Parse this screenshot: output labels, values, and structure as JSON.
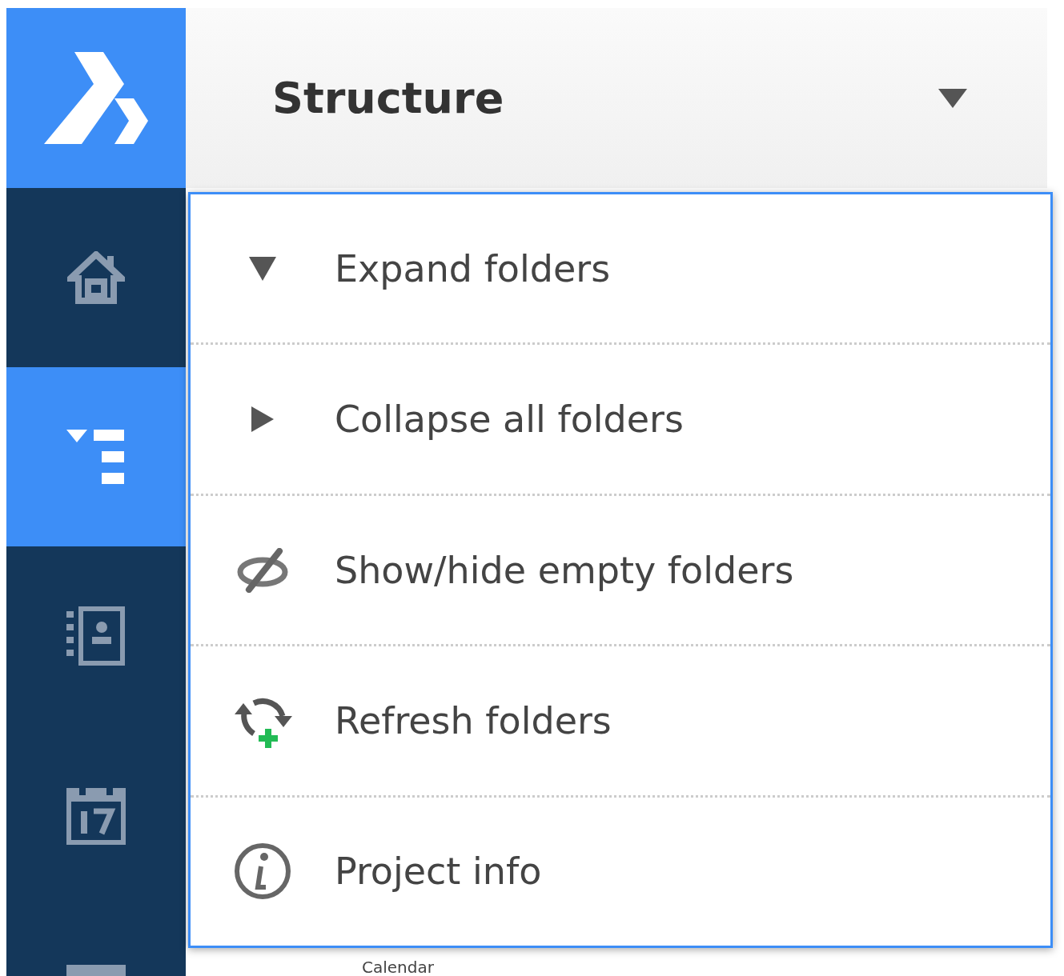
{
  "sidebar": {
    "items": [
      {
        "selected": false
      },
      {
        "selected": true
      },
      {
        "selected": false
      },
      {
        "selected": false
      },
      {
        "selected": false
      }
    ]
  },
  "header": {
    "title": "Structure"
  },
  "menu": {
    "items": [
      {
        "label": "Expand folders"
      },
      {
        "label": "Collapse all folders"
      },
      {
        "label": "Show/hide empty folders"
      },
      {
        "label": "Refresh folders"
      },
      {
        "label": "Project info"
      }
    ]
  },
  "list": {
    "items": [
      {
        "label": "Calendar"
      }
    ]
  }
}
